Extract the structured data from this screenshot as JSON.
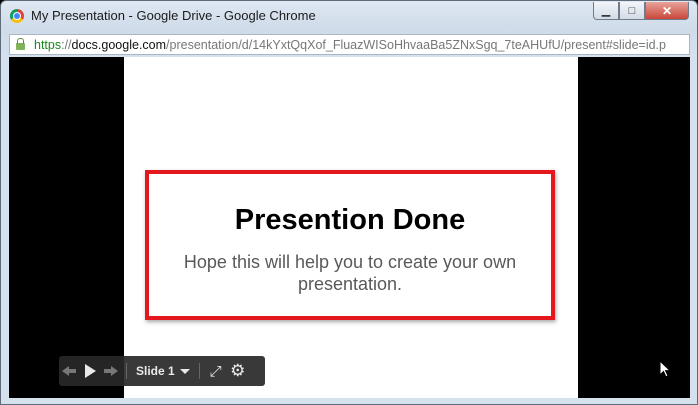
{
  "window": {
    "title": "My Presentation - Google Drive - Google Chrome",
    "buttons": {
      "minimize": "▁",
      "maximize": "□",
      "close": "✕"
    }
  },
  "address": {
    "scheme": "https",
    "separator": "://",
    "host": "docs.google.com",
    "path": "/presentation/d/14kYxtQqXof_FluazWISoHhvaaBa5ZNxSgq_7teAHUfU/present#slide=id.p"
  },
  "slide": {
    "title": "Presention Done",
    "subtitle": "Hope this will help you to create your own presentation.",
    "box_color": "#e3171c"
  },
  "controls": {
    "slide_label": "Slide 1",
    "icons": [
      "prev-arrow-icon",
      "play-icon",
      "next-arrow-icon",
      "fullscreen-icon",
      "gear-icon"
    ]
  }
}
